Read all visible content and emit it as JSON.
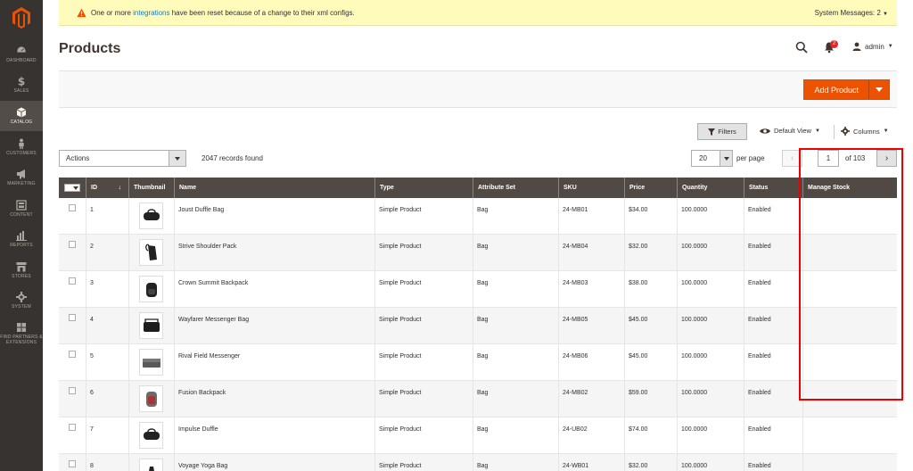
{
  "sidebar": {
    "items": [
      {
        "label": "Dashboard",
        "icon": "dashboard-icon"
      },
      {
        "label": "Sales",
        "icon": "dollar-icon"
      },
      {
        "label": "Catalog",
        "icon": "box-icon",
        "active": true
      },
      {
        "label": "Customers",
        "icon": "person-icon"
      },
      {
        "label": "Marketing",
        "icon": "megaphone-icon"
      },
      {
        "label": "Content",
        "icon": "layout-icon"
      },
      {
        "label": "Reports",
        "icon": "bar-chart-icon"
      },
      {
        "label": "Stores",
        "icon": "store-icon"
      },
      {
        "label": "System",
        "icon": "gear-icon"
      },
      {
        "label": "Find Partners & Extensions",
        "icon": "blocks-icon"
      }
    ]
  },
  "system_message": {
    "before_link": "One or more ",
    "link": "integrations",
    "after_link": " have been reset because of a change to their xml configs.",
    "counter": "System Messages: 2"
  },
  "header": {
    "title": "Products",
    "notification_count": "2",
    "user": "admin",
    "add_product": "Add Product"
  },
  "toolbar": {
    "filters": "Filters",
    "default_view": "Default View",
    "columns": "Columns",
    "actions": "Actions",
    "records_found": "2047 records found",
    "per_page_value": "20",
    "per_page_label": "per page",
    "current_page": "1",
    "of_pages": "of 103"
  },
  "table": {
    "headers": [
      "ID",
      "Thumbnail",
      "Name",
      "Type",
      "Attribute Set",
      "SKU",
      "Price",
      "Quantity",
      "Status",
      "Manage Stock"
    ],
    "rows": [
      {
        "id": "1",
        "name": "Joust Duffle Bag",
        "type": "Simple Product",
        "attribute_set": "Bag",
        "sku": "24-MB01",
        "price": "$34.00",
        "quantity": "100.0000",
        "status": "Enabled",
        "thumb": "duffle"
      },
      {
        "id": "2",
        "name": "Strive Shoulder Pack",
        "type": "Simple Product",
        "attribute_set": "Bag",
        "sku": "24-MB04",
        "price": "$32.00",
        "quantity": "100.0000",
        "status": "Enabled",
        "thumb": "shoulder"
      },
      {
        "id": "3",
        "name": "Crown Summit Backpack",
        "type": "Simple Product",
        "attribute_set": "Bag",
        "sku": "24-MB03",
        "price": "$38.00",
        "quantity": "100.0000",
        "status": "Enabled",
        "thumb": "backpack"
      },
      {
        "id": "4",
        "name": "Wayfarer Messenger Bag",
        "type": "Simple Product",
        "attribute_set": "Bag",
        "sku": "24-MB05",
        "price": "$45.00",
        "quantity": "100.0000",
        "status": "Enabled",
        "thumb": "messenger"
      },
      {
        "id": "5",
        "name": "Rival Field Messenger",
        "type": "Simple Product",
        "attribute_set": "Bag",
        "sku": "24-MB06",
        "price": "$45.00",
        "quantity": "100.0000",
        "status": "Enabled",
        "thumb": "field"
      },
      {
        "id": "6",
        "name": "Fusion Backpack",
        "type": "Simple Product",
        "attribute_set": "Bag",
        "sku": "24-MB02",
        "price": "$59.00",
        "quantity": "100.0000",
        "status": "Enabled",
        "thumb": "fusion"
      },
      {
        "id": "7",
        "name": "Impulse Duffle",
        "type": "Simple Product",
        "attribute_set": "Bag",
        "sku": "24-UB02",
        "price": "$74.00",
        "quantity": "100.0000",
        "status": "Enabled",
        "thumb": "duffle"
      },
      {
        "id": "8",
        "name": "Voyage Yoga Bag",
        "type": "Simple Product",
        "attribute_set": "Bag",
        "sku": "24-WB01",
        "price": "$32.00",
        "quantity": "100.0000",
        "status": "Enabled",
        "thumb": "yoga"
      }
    ]
  },
  "colors": {
    "sidebar_bg": "#373330",
    "sidebar_active": "#524d49",
    "accent": "#eb5202",
    "table_header": "#514943",
    "message_bg": "#fffbbb",
    "highlight": "#ee0000"
  }
}
